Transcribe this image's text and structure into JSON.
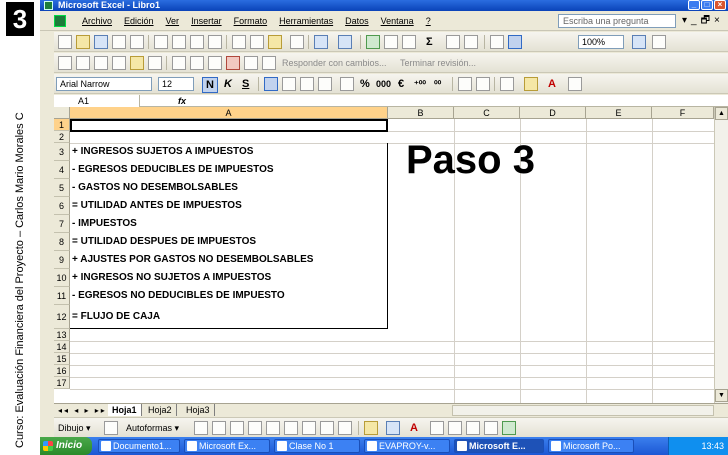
{
  "slide": {
    "number": "3",
    "side_text": "Curso: Evaluación Financiera del Proyecto – Carlos Mario Morales C"
  },
  "window": {
    "title": "Microsoft Excel - Libro1",
    "buttons": [
      "_",
      "□",
      "×"
    ]
  },
  "menu": {
    "items": [
      "Archivo",
      "Edición",
      "Ver",
      "Insertar",
      "Formato",
      "Herramientas",
      "Datos",
      "Ventana",
      "?"
    ],
    "question_box": "Escriba una pregunta",
    "right_glyphs": [
      "▾",
      "_",
      "🗗",
      "×"
    ]
  },
  "toolbar": {
    "zoom": "100%",
    "review_text_1": "Responder con cambios...",
    "review_text_2": "Terminar revisión...",
    "font_name": "Arial Narrow",
    "font_size": "12",
    "glyphs": {
      "sum": "Σ",
      "bold": "N",
      "italic": "K",
      "underline": "S",
      "percent": "%",
      "thousands": "000",
      "euro": "€",
      "dec_inc": "⁺⁰⁰",
      "dec_dec": "⁰⁰",
      "fontcolor": "A"
    }
  },
  "formula": {
    "name_box": "A1",
    "fx": "fx",
    "value": ""
  },
  "grid": {
    "columns": [
      "A",
      "B",
      "C",
      "D",
      "E",
      "F"
    ],
    "rows": [
      "1",
      "2",
      "3",
      "4",
      "5",
      "6",
      "7",
      "8",
      "9",
      "10",
      "11",
      "12",
      "13",
      "14",
      "15",
      "16",
      "17"
    ],
    "cells_col_a": [
      "",
      "",
      "+  INGRESOS SUJETOS A IMPUESTOS",
      "-  EGRESOS DEDUCIBLES DE IMPUESTOS",
      " - GASTOS NO DESEMBOLSABLES",
      " = UTILIDAD ANTES DE IMPUESTOS",
      " - IMPUESTOS",
      " = UTILIDAD DESPUES DE IMPUESTOS",
      " + AJUSTES POR GASTOS NO DESEMBOLSABLES",
      " + INGRESOS NO SUJETOS A IMPUESTOS",
      " - EGRESOS NO DEDUCIBLES DE IMPUESTO",
      " = FLUJO DE CAJA"
    ],
    "overlay_title": "Paso 3"
  },
  "sheets": {
    "nav": "◂◂ ◂ ▸ ▸▸",
    "tabs": [
      "Hoja1",
      "Hoja2",
      "Hoja3"
    ],
    "active": "Hoja1"
  },
  "drawing": {
    "draw_label": "Dibujo ▾",
    "autoshapes_label": "Autoformas ▾"
  },
  "taskbar": {
    "start": "Inicio",
    "buttons": [
      "Documento1...",
      "Microsoft Ex...",
      "Clase No 1",
      "EVAPROY-v...",
      "Microsoft E...",
      "Microsoft Po..."
    ],
    "active_index": 4,
    "time": "13:43"
  }
}
